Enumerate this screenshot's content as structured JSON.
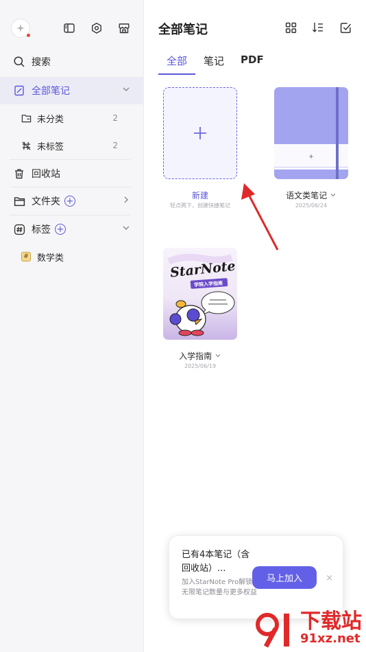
{
  "sidebar": {
    "search_label": "搜索",
    "items": [
      {
        "label": "全部笔记"
      },
      {
        "label": "未分类",
        "count": "2"
      },
      {
        "label": "未标签",
        "count": "2"
      },
      {
        "label": "回收站"
      },
      {
        "label": "文件夹"
      },
      {
        "label": "标签"
      },
      {
        "label": "数学类"
      }
    ]
  },
  "main": {
    "title": "全部笔记",
    "tabs": [
      {
        "label": "全部"
      },
      {
        "label": "笔记"
      },
      {
        "label": "PDF"
      }
    ],
    "new_card": {
      "label": "新建",
      "hint": "轻点两下，创建快捷笔记"
    },
    "notebooks": [
      {
        "label": "语文类笔记",
        "date": "2025/06/24"
      },
      {
        "label": "入学指南",
        "date": "2025/06/19",
        "cover_title": "StarNote",
        "cover_banner": "学院入学指南"
      }
    ]
  },
  "promo": {
    "title": "已有4本笔记（含回收站）...",
    "subtitle": "加入StarNote Pro解锁无限笔记数量与更多权益",
    "button": "马上加入",
    "close": "×"
  },
  "watermark": {
    "text": "下载站",
    "url": "91xz.net"
  },
  "colors": {
    "accent": "#5b57d9",
    "button": "#6360e8",
    "annotation_arrow": "#e02929"
  }
}
